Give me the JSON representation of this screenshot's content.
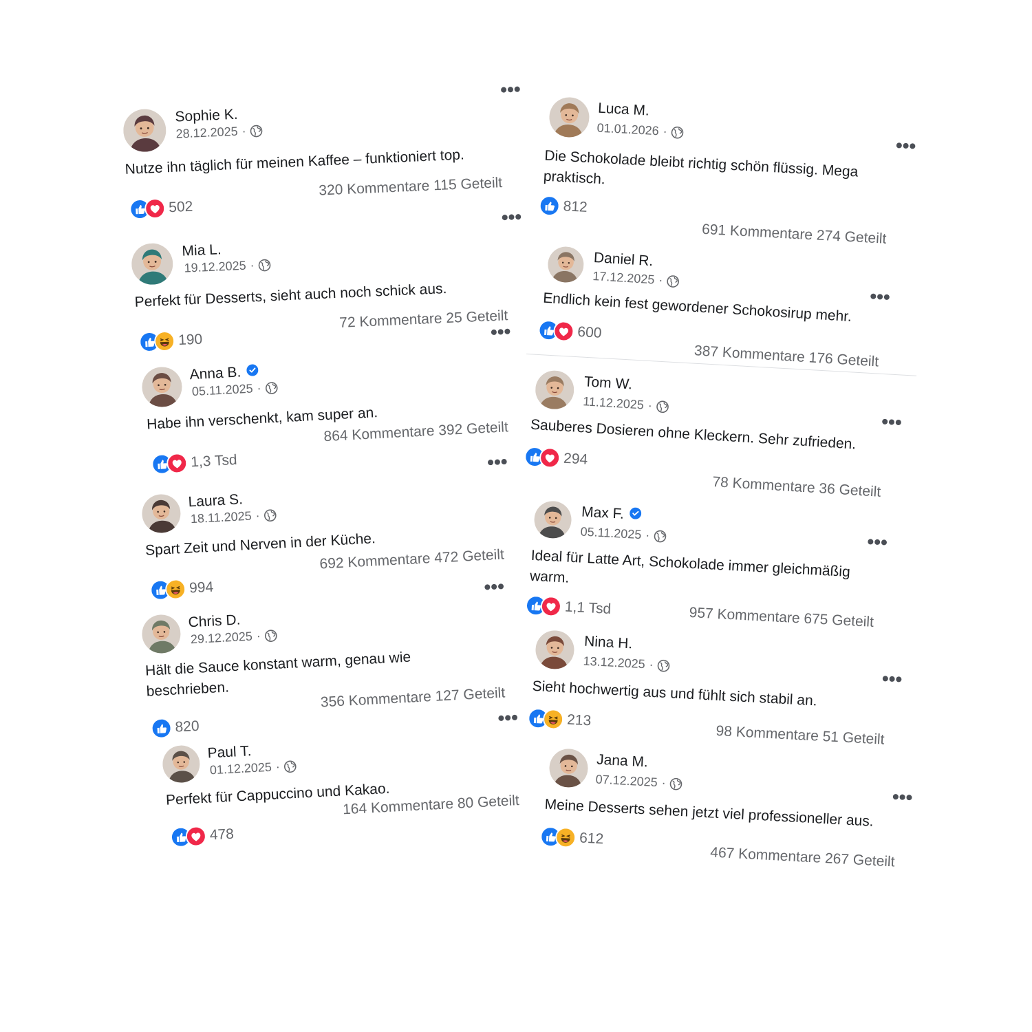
{
  "posts": [
    {
      "name": "Sophie K.",
      "date": "28.12.2025",
      "text": "Nutze ihn täglich für meinen Kaffee – funktioniert top.",
      "reactions": [
        "like",
        "love"
      ],
      "count": "502",
      "stats": "320 Kommentare 115 Geteilt",
      "verified": false,
      "avatar_color": "#5a3b3f"
    },
    {
      "name": "Mia L.",
      "date": "19.12.2025",
      "text": "Perfekt für Desserts, sieht auch noch schick aus.",
      "reactions": [
        "like",
        "haha"
      ],
      "count": "190",
      "stats": "72 Kommentare 25 Geteilt",
      "verified": false,
      "avatar_color": "#2f7a78"
    },
    {
      "name": "Anna B.",
      "date": "05.11.2025",
      "text": "Habe ihn verschenkt, kam super an.",
      "reactions": [
        "like",
        "love"
      ],
      "count": "1,3 Tsd",
      "stats": "864 Kommentare 392 Geteilt",
      "verified": true,
      "avatar_color": "#6b4d44"
    },
    {
      "name": "Laura S.",
      "date": "18.11.2025",
      "text": "Spart Zeit und Nerven in der Küche.",
      "reactions": [
        "like",
        "haha"
      ],
      "count": "994",
      "stats": "692 Kommentare 472 Geteilt",
      "verified": false,
      "avatar_color": "#4a3a36"
    },
    {
      "name": "Chris D.",
      "date": "29.12.2025",
      "text": "Hält die Sauce konstant warm, genau wie\nbeschrieben.",
      "reactions": [
        "like"
      ],
      "count": "820",
      "stats": "356 Kommentare 127 Geteilt",
      "verified": false,
      "avatar_color": "#6f7a66"
    },
    {
      "name": "Paul T.",
      "date": "01.12.2025",
      "text": "Perfekt für Cappuccino und Kakao.",
      "reactions": [
        "like",
        "love"
      ],
      "count": "478",
      "stats": "164 Kommentare 80 Geteilt",
      "verified": false,
      "avatar_color": "#5b5048"
    },
    {
      "name": "Luca M.",
      "date": "01.01.2026",
      "text": "Die Schokolade bleibt richtig schön flüssig. Mega\npraktisch.",
      "reactions": [
        "like"
      ],
      "count": "812",
      "stats": "691 Kommentare 274 Geteilt",
      "verified": false,
      "avatar_color": "#a07a58"
    },
    {
      "name": "Daniel R.",
      "date": "17.12.2025",
      "text": "Endlich kein fest gewordener Schokosirup mehr.",
      "reactions": [
        "like",
        "love"
      ],
      "count": "600",
      "stats": "387 Kommentare 176 Geteilt",
      "verified": false,
      "avatar_color": "#8a7563"
    },
    {
      "name": "Tom W.",
      "date": "11.12.2025",
      "text": "Sauberes Dosieren ohne Kleckern. Sehr zufrieden.",
      "reactions": [
        "like",
        "love"
      ],
      "count": "294",
      "stats": "78 Kommentare 36 Geteilt",
      "verified": false,
      "avatar_color": "#9a7c62"
    },
    {
      "name": "Max F.",
      "date": "05.11.2025",
      "text": "Ideal für Latte Art, Schokolade immer gleichmäßig\nwarm.",
      "reactions": [
        "like",
        "love"
      ],
      "count": "1,1 Tsd",
      "stats": "957 Kommentare 675 Geteilt",
      "verified": true,
      "avatar_color": "#4c4c4c"
    },
    {
      "name": "Nina H.",
      "date": "13.12.2025",
      "text": "Sieht hochwertig aus und fühlt sich stabil an.",
      "reactions": [
        "like",
        "haha"
      ],
      "count": "213",
      "stats": "98 Kommentare 51 Geteilt",
      "verified": false,
      "avatar_color": "#7a4a3a"
    },
    {
      "name": "Jana M.",
      "date": "07.12.2025",
      "text": "Meine Desserts sehen jetzt viel professioneller aus.",
      "reactions": [
        "like",
        "haha"
      ],
      "count": "612",
      "stats": "467 Kommentare 267 Geteilt",
      "verified": false,
      "avatar_color": "#6a5246"
    }
  ],
  "more_label": "•••",
  "dot_separator": "·",
  "icons": {
    "globe": "globe-icon",
    "like": "like-reaction-icon",
    "love": "love-reaction-icon",
    "haha": "haha-reaction-icon",
    "verified": "verified-badge-icon",
    "more": "more-options-icon"
  }
}
